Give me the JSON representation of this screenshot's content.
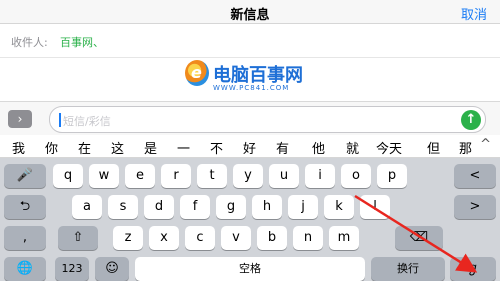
{
  "nav": {
    "title": "新信息",
    "cancel": "取消"
  },
  "recipient": {
    "label": "收件人:",
    "value": "百事网、"
  },
  "watermark": {
    "brand": "电脑百事网",
    "url": "WWW.PC841.COM"
  },
  "compose": {
    "placeholder": "短信/彩信",
    "expand_glyph": "›",
    "send_glyph": "↑"
  },
  "candidates": [
    "我",
    "你",
    "在",
    "这",
    "是",
    "一",
    "不",
    "好",
    "有",
    "他",
    "就",
    "今天",
    "但",
    "那"
  ],
  "candidate_expand": "^",
  "keyboard": {
    "row1": [
      "q",
      "w",
      "e",
      "r",
      "t",
      "y",
      "u",
      "i",
      "o",
      "p"
    ],
    "row2": [
      "a",
      "s",
      "d",
      "f",
      "g",
      "h",
      "j",
      "k",
      "l"
    ],
    "row3": [
      "z",
      "x",
      "c",
      "v",
      "b",
      "n",
      "m"
    ],
    "mic": "🎤",
    "left": "<",
    "undo": "⮌",
    "right": ">",
    "comma": ",",
    "shift": "⇧",
    "delete": "⌫",
    "globe": "🌐",
    "numbers": "123",
    "emoji": "☺",
    "space": "空格",
    "return": "换行",
    "handwrite": "ℊ"
  },
  "colors": {
    "accent": "#1a7cf5",
    "green": "#2bb14a",
    "annotation": "#e8261f"
  }
}
